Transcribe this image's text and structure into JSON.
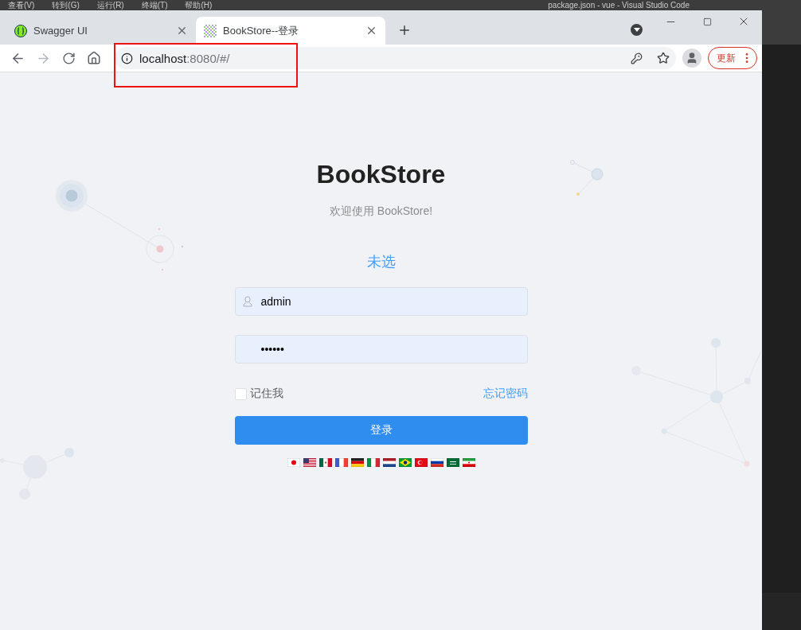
{
  "editor_menu": [
    "查看(V)",
    "转到(G)",
    "运行(R)",
    "终端(T)",
    "帮助(H)"
  ],
  "editor_title": "package.json - vue - Visual Studio Code",
  "tabs": [
    {
      "label": "Swagger UI",
      "selected": false,
      "kind": "swagger"
    },
    {
      "label": "BookStore--登录",
      "selected": true,
      "kind": "bookstore"
    }
  ],
  "nav": {
    "forward_disabled": true
  },
  "address": {
    "host": "localhost",
    "rest": ":8080/#/"
  },
  "update_button": "更新",
  "login": {
    "title": "BookStore",
    "subtitle": "欢迎使用 BookStore!",
    "language": "未选",
    "username": "admin",
    "password": "••••••",
    "remember": {
      "label": "记住我",
      "checked": false
    },
    "forgot": "忘记密码",
    "submit": "登录",
    "flags": [
      {
        "kind": "jp"
      },
      {
        "kind": "us"
      },
      {
        "kind": "mx"
      },
      {
        "kind": "fr"
      },
      {
        "kind": "de"
      },
      {
        "kind": "it"
      },
      {
        "kind": "nl"
      },
      {
        "kind": "br"
      },
      {
        "kind": "tr"
      },
      {
        "kind": "ru"
      },
      {
        "kind": "sa"
      },
      {
        "kind": "ir"
      }
    ]
  }
}
